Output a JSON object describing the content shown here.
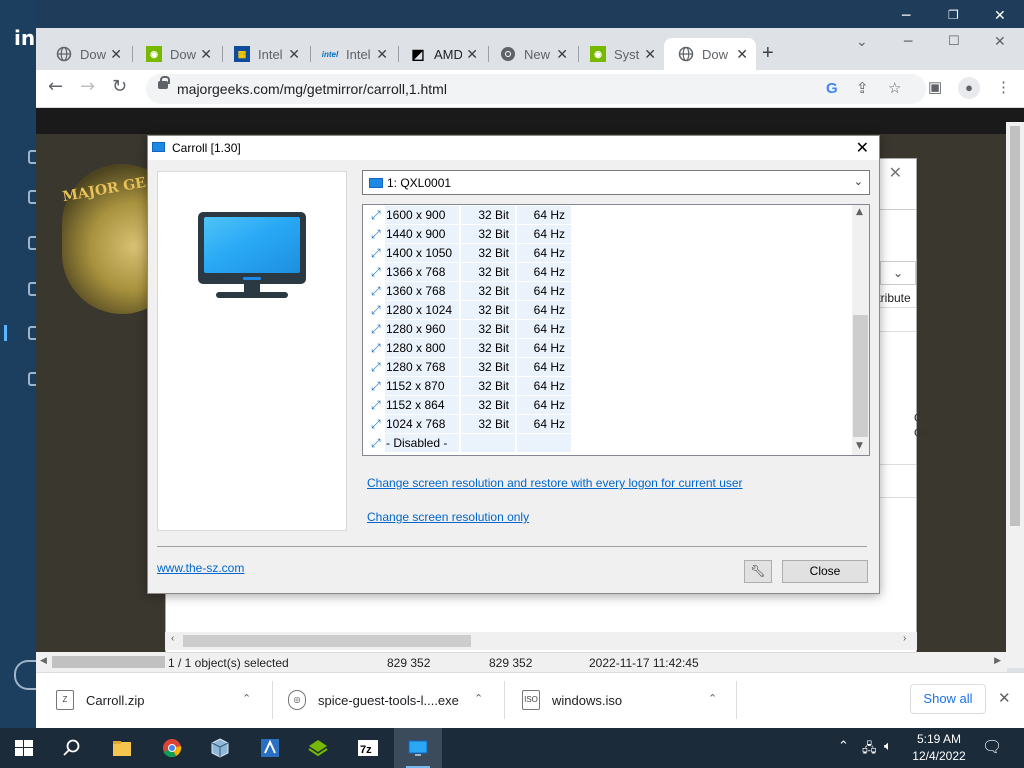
{
  "desktop": {
    "side_logo": "in"
  },
  "browser": {
    "tabs": [
      {
        "label": "Dow",
        "icon": "globe-icon"
      },
      {
        "label": "Dow",
        "icon": "nvidia-icon"
      },
      {
        "label": "Intel",
        "icon": "windows-store-icon"
      },
      {
        "label": "Intel",
        "icon": "intel-icon"
      },
      {
        "label": "AMD",
        "icon": "amd-icon"
      },
      {
        "label": "New",
        "icon": "chrome-icon"
      },
      {
        "label": "Syst",
        "icon": "nvidia-icon"
      },
      {
        "label": "Dow",
        "icon": "globe-icon",
        "active": true
      }
    ],
    "url": "majorgeeks.com/mg/getmirror/carroll,1.html"
  },
  "page": {
    "logo_text": "MAJOR GE"
  },
  "explorer": {
    "attribute_header": "ttribute",
    "truncated_text": "d or.....",
    "status": {
      "selected": "1 / 1 object(s) selected",
      "size1": "829 352",
      "size2": "829 352",
      "date": "2022-11-17 11:42:45"
    }
  },
  "carroll": {
    "title": "Carroll [1.30]",
    "display_select": "1: QXL0001",
    "modes": [
      {
        "res": "1600 x 900",
        "depth": "32 Bit",
        "hz": "64 Hz"
      },
      {
        "res": "1440 x 900",
        "depth": "32 Bit",
        "hz": "64 Hz"
      },
      {
        "res": "1400 x 1050",
        "depth": "32 Bit",
        "hz": "64 Hz"
      },
      {
        "res": "1366 x 768",
        "depth": "32 Bit",
        "hz": "64 Hz"
      },
      {
        "res": "1360 x 768",
        "depth": "32 Bit",
        "hz": "64 Hz"
      },
      {
        "res": "1280 x 1024",
        "depth": "32 Bit",
        "hz": "64 Hz"
      },
      {
        "res": "1280 x 960",
        "depth": "32 Bit",
        "hz": "64 Hz"
      },
      {
        "res": "1280 x 800",
        "depth": "32 Bit",
        "hz": "64 Hz"
      },
      {
        "res": "1280 x 768",
        "depth": "32 Bit",
        "hz": "64 Hz"
      },
      {
        "res": "1152 x 870",
        "depth": "32 Bit",
        "hz": "64 Hz"
      },
      {
        "res": "1152 x 864",
        "depth": "32 Bit",
        "hz": "64 Hz"
      },
      {
        "res": "1024 x 768",
        "depth": "32 Bit",
        "hz": "64 Hz"
      },
      {
        "res": "- Disabled -",
        "depth": "",
        "hz": ""
      }
    ],
    "link_restore": "Change screen resolution and restore with every logon for current user",
    "link_only": "Change screen resolution only",
    "site": "www.the-sz.com",
    "close_label": "Close"
  },
  "downloads": [
    {
      "name": "Carroll.zip",
      "icon": "zip-file-icon"
    },
    {
      "name": "spice-guest-tools-l....exe",
      "icon": "installer-icon"
    },
    {
      "name": "windows.iso",
      "icon": "iso-file-icon"
    }
  ],
  "downloads_show_all": "Show all",
  "taskbar": {
    "time": "5:19 AM",
    "date": "12/4/2022"
  }
}
